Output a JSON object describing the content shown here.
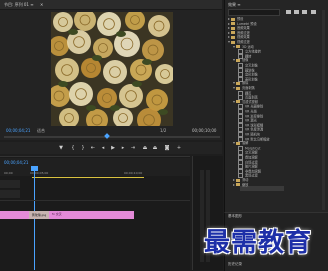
{
  "monitor": {
    "tab_title": "节目: 序列 01 ≡",
    "close_x": "✕",
    "timecode_left": "00;00;04;21",
    "fit": "适合",
    "ratio": "1/2",
    "timecode_right": "00;00;10;00"
  },
  "transport_icons": [
    "marker-icon",
    "in-point-icon",
    "out-point-icon",
    "go-to-in-icon",
    "step-back-icon",
    "play-icon",
    "step-forward-icon",
    "go-to-out-icon",
    "lift-icon",
    "extract-icon",
    "export-frame-icon",
    "button-editor-icon"
  ],
  "timeline": {
    "timecode": "00;00;04;21",
    "ruler_labels": [
      "00;00",
      "00;00;05;00",
      "00;00;10;00"
    ],
    "clip_label": "黄玫瑰.jpg",
    "clip_fx": "fx 交叉",
    "accent": "#4aa3ff",
    "clip_color": "#e38ad8"
  },
  "effects": {
    "tab": "效果 ≡",
    "tree": [
      {
        "label": "预设",
        "level": 0,
        "type": "folder"
      },
      {
        "label": "Lumetri 预设",
        "level": 0,
        "type": "folder"
      },
      {
        "label": "音频效果",
        "level": 0,
        "type": "folder"
      },
      {
        "label": "音频过渡",
        "level": 0,
        "type": "folder"
      },
      {
        "label": "视频效果",
        "level": 0,
        "type": "folder"
      },
      {
        "label": "视频过渡",
        "level": 0,
        "type": "folder",
        "open": true
      },
      {
        "label": "3D 运动",
        "level": 1,
        "type": "folder",
        "open": true
      },
      {
        "label": "立方体旋转",
        "level": 2,
        "type": "fx"
      },
      {
        "label": "翻转",
        "level": 2,
        "type": "fx"
      },
      {
        "label": "划像",
        "level": 1,
        "type": "folder",
        "open": true
      },
      {
        "label": "交叉划像",
        "level": 2,
        "type": "fx"
      },
      {
        "label": "圆划像",
        "level": 2,
        "type": "fx"
      },
      {
        "label": "盒形划像",
        "level": 2,
        "type": "fx"
      },
      {
        "label": "菱形划像",
        "level": 2,
        "type": "fx"
      },
      {
        "label": "擦除",
        "level": 1,
        "type": "folder",
        "open": true
      },
      {
        "label": "页面剥落",
        "level": 1,
        "type": "folder",
        "open": true
      },
      {
        "label": "翻页",
        "level": 2,
        "type": "fx"
      },
      {
        "label": "页面剥落",
        "level": 2,
        "type": "fx"
      },
      {
        "label": "沉浸式视频",
        "level": 1,
        "type": "folder",
        "open": true
      },
      {
        "label": "VR 光圈擦除",
        "level": 2,
        "type": "fx"
      },
      {
        "label": "VR 光线",
        "level": 2,
        "type": "fx"
      },
      {
        "label": "VR 渐变擦除",
        "level": 2,
        "type": "fx"
      },
      {
        "label": "VR 漏光",
        "level": 2,
        "type": "fx"
      },
      {
        "label": "VR 球形模糊",
        "level": 2,
        "type": "fx"
      },
      {
        "label": "VR 色度泄漏",
        "level": 2,
        "type": "fx"
      },
      {
        "label": "VR 随机块",
        "level": 2,
        "type": "fx"
      },
      {
        "label": "VR 默比乌斯缩放",
        "level": 2,
        "type": "fx"
      },
      {
        "label": "溶解",
        "level": 1,
        "type": "folder",
        "open": true
      },
      {
        "label": "MorphCut",
        "level": 2,
        "type": "fx"
      },
      {
        "label": "交叉溶解",
        "level": 2,
        "type": "fx"
      },
      {
        "label": "叠加溶解",
        "level": 2,
        "type": "fx"
      },
      {
        "label": "白场过渡",
        "level": 2,
        "type": "fx"
      },
      {
        "label": "胶片溶解",
        "level": 2,
        "type": "fx"
      },
      {
        "label": "非叠加溶解",
        "level": 2,
        "type": "fx"
      },
      {
        "label": "黑场过渡",
        "level": 2,
        "type": "fx"
      },
      {
        "label": "滑动",
        "level": 1,
        "type": "folder"
      },
      {
        "label": "缩放",
        "level": 1,
        "type": "folder"
      }
    ]
  },
  "panel2": {
    "title": "基本图形"
  },
  "panel3": {
    "title": "历史记录"
  },
  "watermark": "最需教育"
}
